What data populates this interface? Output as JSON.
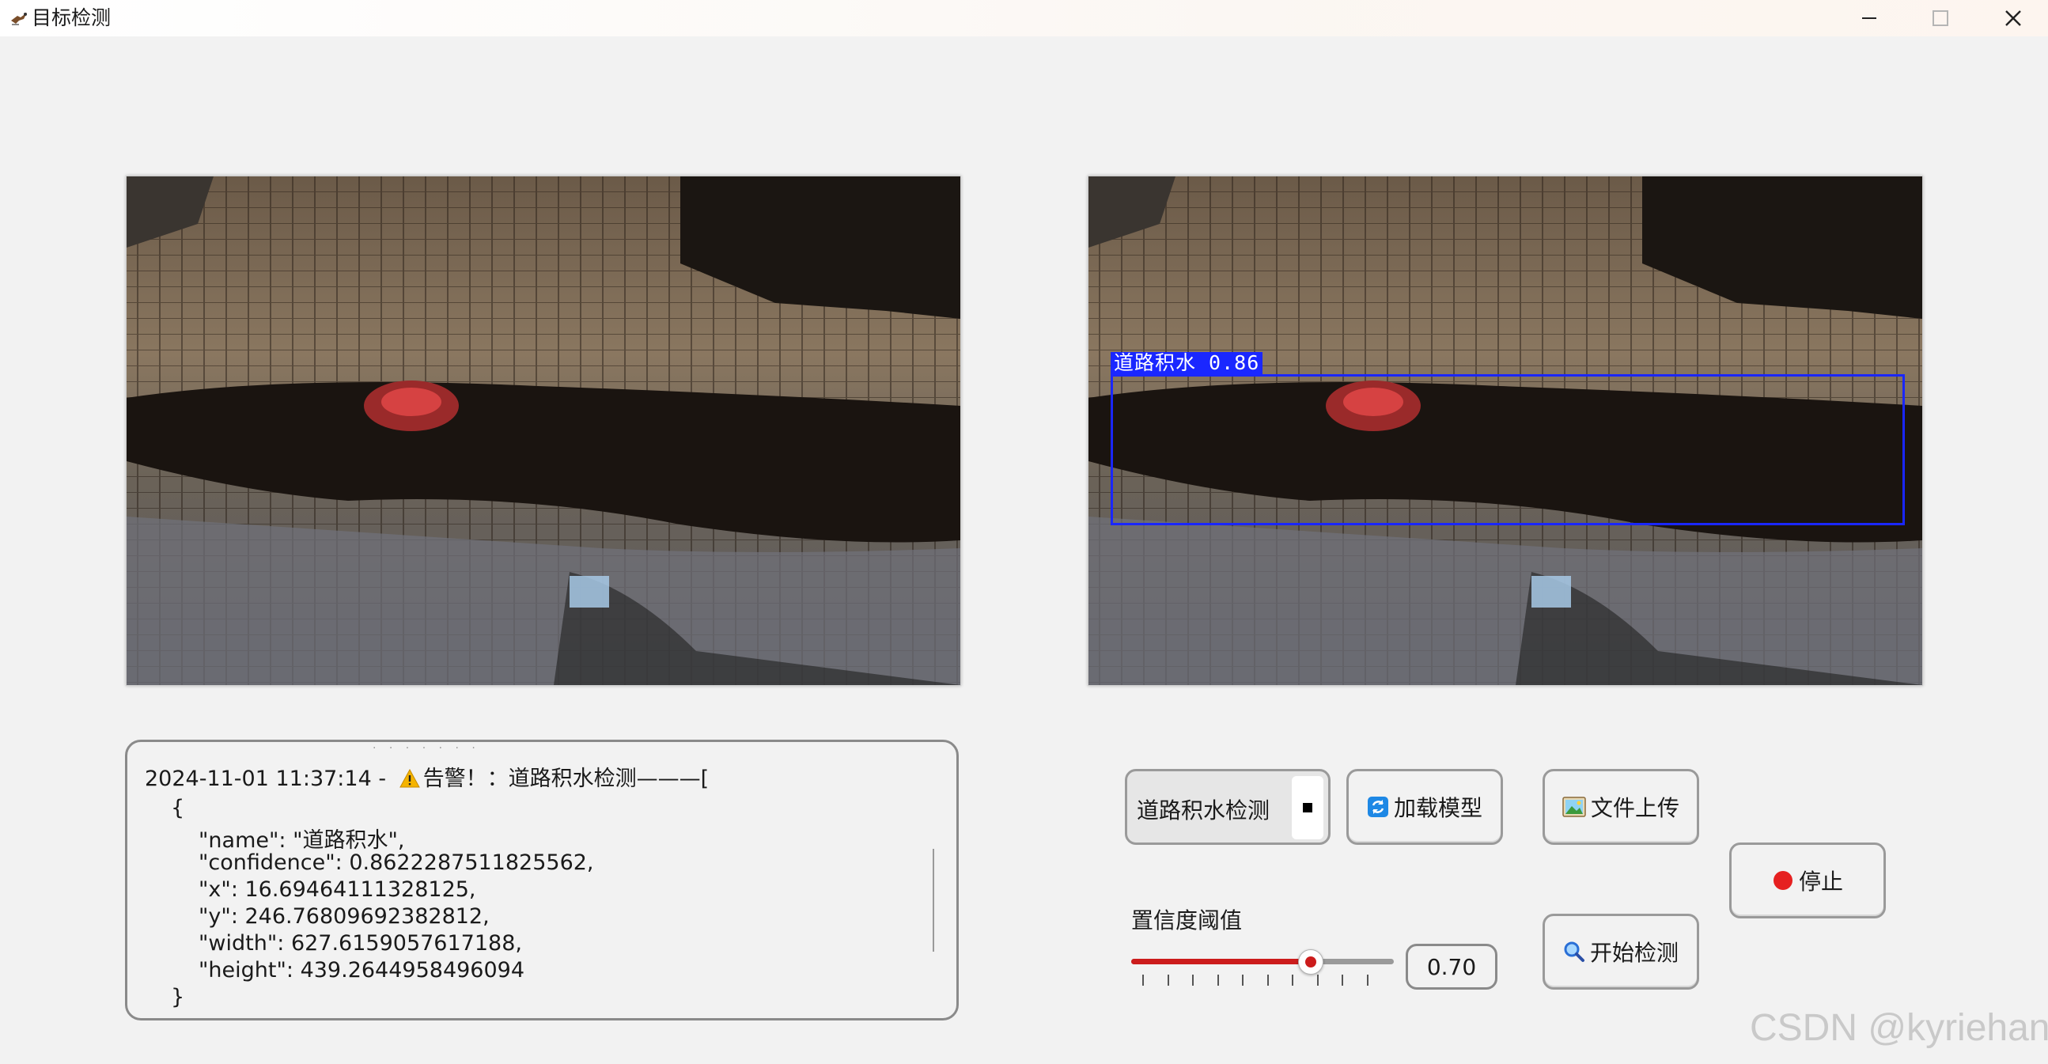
{
  "window": {
    "title": "目标检测",
    "icon": "app-bird-icon"
  },
  "detection": {
    "label": "道路积水 0.86"
  },
  "log": {
    "header_time": "2024-11-01 11:37:14 -",
    "header_alert": "告警！：道路积水检测———[",
    "lines": [
      "{",
      "\"name\": \"道路积水\",",
      "\"confidence\": 0.8622287511825562,",
      "\"x\": 16.69464111328125,",
      "\"y\": 246.76809692382812,",
      "\"width\": 627.6159057617188,",
      "\"height\": 439.2644958496094",
      "}"
    ]
  },
  "controls": {
    "model_select_value": "道路积水检测",
    "load_model": "加载模型",
    "file_upload": "文件上传",
    "start_detect": "开始检测",
    "stop": "停止",
    "threshold_label": "置信度阈值",
    "threshold_value": "0.70",
    "threshold": 0.7
  },
  "watermark": "CSDN @kyriehan",
  "colors": {
    "box": "#1a27ff",
    "slider": "#cc1c1c",
    "stop_dot": "#e62020"
  }
}
